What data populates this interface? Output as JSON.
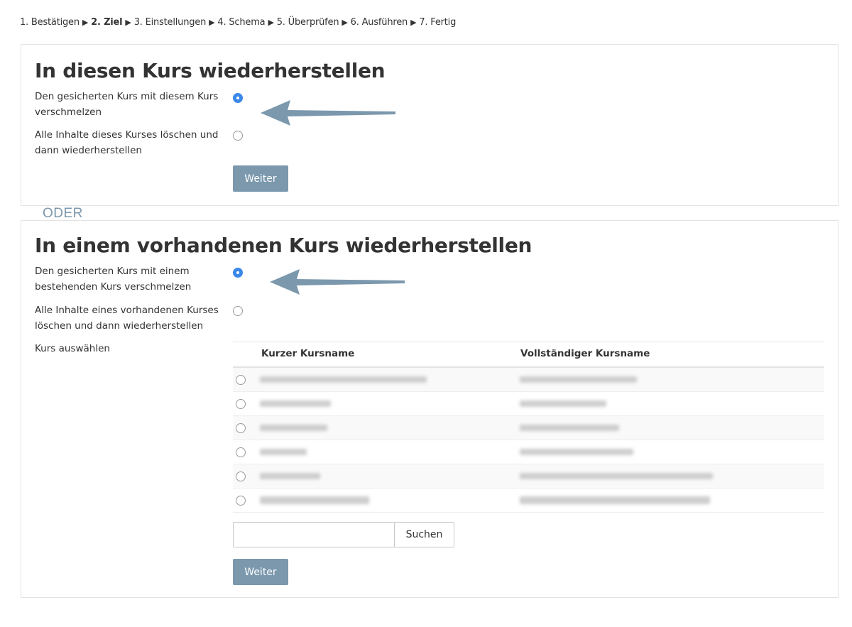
{
  "breadcrumb": {
    "steps": [
      {
        "label": "1. Bestätigen",
        "current": false
      },
      {
        "label": "2. Ziel",
        "current": true
      },
      {
        "label": "3. Einstellungen",
        "current": false
      },
      {
        "label": "4. Schema",
        "current": false
      },
      {
        "label": "5. Überprüfen",
        "current": false
      },
      {
        "label": "6. Ausführen",
        "current": false
      },
      {
        "label": "7. Fertig",
        "current": false
      }
    ],
    "separator": "▶"
  },
  "section1": {
    "title": "In diesen Kurs wiederherstellen",
    "options": [
      {
        "label": "Den gesicherten Kurs mit diesem Kurs verschmelzen",
        "checked": true
      },
      {
        "label": "Alle Inhalte dieses Kurses löschen und dann wiederherstellen",
        "checked": false
      }
    ],
    "continue_label": "Weiter"
  },
  "or_label": "ODER",
  "section2": {
    "title": "In einem vorhandenen Kurs wiederherstellen",
    "options": [
      {
        "label": "Den gesicherten Kurs mit einem bestehenden Kurs verschmelzen",
        "checked": true
      },
      {
        "label": "Alle Inhalte eines vorhandenen Kurses löschen und dann wiederherstellen",
        "checked": false
      }
    ],
    "select_course_label": "Kurs auswählen",
    "table": {
      "columns": [
        "Kurzer Kursname",
        "Vollständiger Kursname"
      ],
      "row_count": 6
    },
    "search_button_label": "Suchen",
    "continue_label": "Weiter"
  },
  "colors": {
    "accent": "#7b98ad",
    "radio_checked": "#3b88e8",
    "arrow": "#7b98ad"
  }
}
